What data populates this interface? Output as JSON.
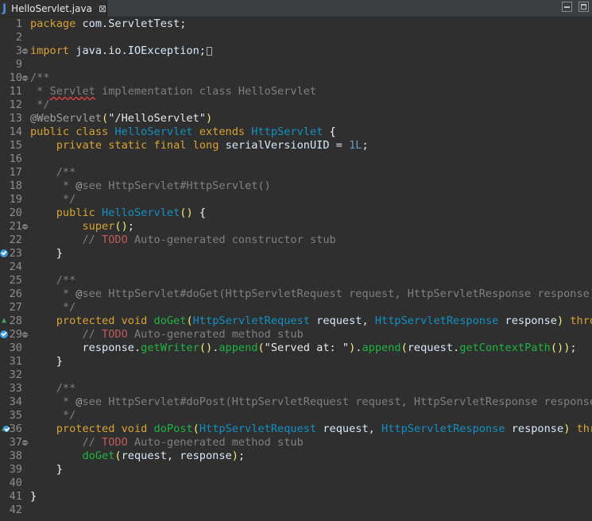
{
  "tab": {
    "icon": "java-file-icon",
    "title": "HelloServlet.java",
    "close": "⊠"
  },
  "window": {
    "minimize_icon": "minimize-icon",
    "maximize_icon": "maximize-icon"
  },
  "colors": {
    "background": "#2f2f2f",
    "keyword": "#d8a334",
    "type": "#1290c3",
    "method": "#1eb540",
    "comment": "#808080",
    "todo": "#bf5c5c",
    "line_number": "#8d8d8d"
  },
  "lines": [
    {
      "n": "1",
      "code": "package com.ServletTest;"
    },
    {
      "n": "2",
      "code": ""
    },
    {
      "n": "3",
      "code": "import java.io.IOException;"
    },
    {
      "n": "9",
      "code": ""
    },
    {
      "n": "10",
      "code": "/**"
    },
    {
      "n": "11",
      "code": " * Servlet implementation class HelloServlet"
    },
    {
      "n": "12",
      "code": " */"
    },
    {
      "n": "13",
      "code": "@WebServlet(\"/HelloServlet\")"
    },
    {
      "n": "14",
      "code": "public class HelloServlet extends HttpServlet {"
    },
    {
      "n": "15",
      "code": "    private static final long serialVersionUID = 1L;"
    },
    {
      "n": "16",
      "code": ""
    },
    {
      "n": "17",
      "code": "    /**"
    },
    {
      "n": "18",
      "code": "     * @see HttpServlet#HttpServlet()"
    },
    {
      "n": "19",
      "code": "     */"
    },
    {
      "n": "20",
      "code": "    public HelloServlet() {"
    },
    {
      "n": "21",
      "code": "        super();"
    },
    {
      "n": "22",
      "code": "        // TODO Auto-generated constructor stub"
    },
    {
      "n": "23",
      "code": "    }"
    },
    {
      "n": "24",
      "code": ""
    },
    {
      "n": "25",
      "code": "    /**"
    },
    {
      "n": "26",
      "code": "     * @see HttpServlet#doGet(HttpServletRequest request, HttpServletResponse response)"
    },
    {
      "n": "27",
      "code": "     */"
    },
    {
      "n": "28",
      "code": "    protected void doGet(HttpServletRequest request, HttpServletResponse response) throw"
    },
    {
      "n": "29",
      "code": "        // TODO Auto-generated method stub"
    },
    {
      "n": "30",
      "code": "        response.getWriter().append(\"Served at: \").append(request.getContextPath());"
    },
    {
      "n": "31",
      "code": "    }"
    },
    {
      "n": "32",
      "code": ""
    },
    {
      "n": "33",
      "code": "    /**"
    },
    {
      "n": "34",
      "code": "     * @see HttpServlet#doPost(HttpServletRequest request, HttpServletResponse response)"
    },
    {
      "n": "35",
      "code": "     */"
    },
    {
      "n": "36",
      "code": "    protected void doPost(HttpServletRequest request, HttpServletResponse response) thro"
    },
    {
      "n": "37",
      "code": "        // TODO Auto-generated method stub"
    },
    {
      "n": "38",
      "code": "        doGet(request, response);"
    },
    {
      "n": "39",
      "code": "    }"
    },
    {
      "n": "40",
      "code": ""
    },
    {
      "n": "41",
      "code": "}"
    },
    {
      "n": "42",
      "code": ""
    }
  ]
}
